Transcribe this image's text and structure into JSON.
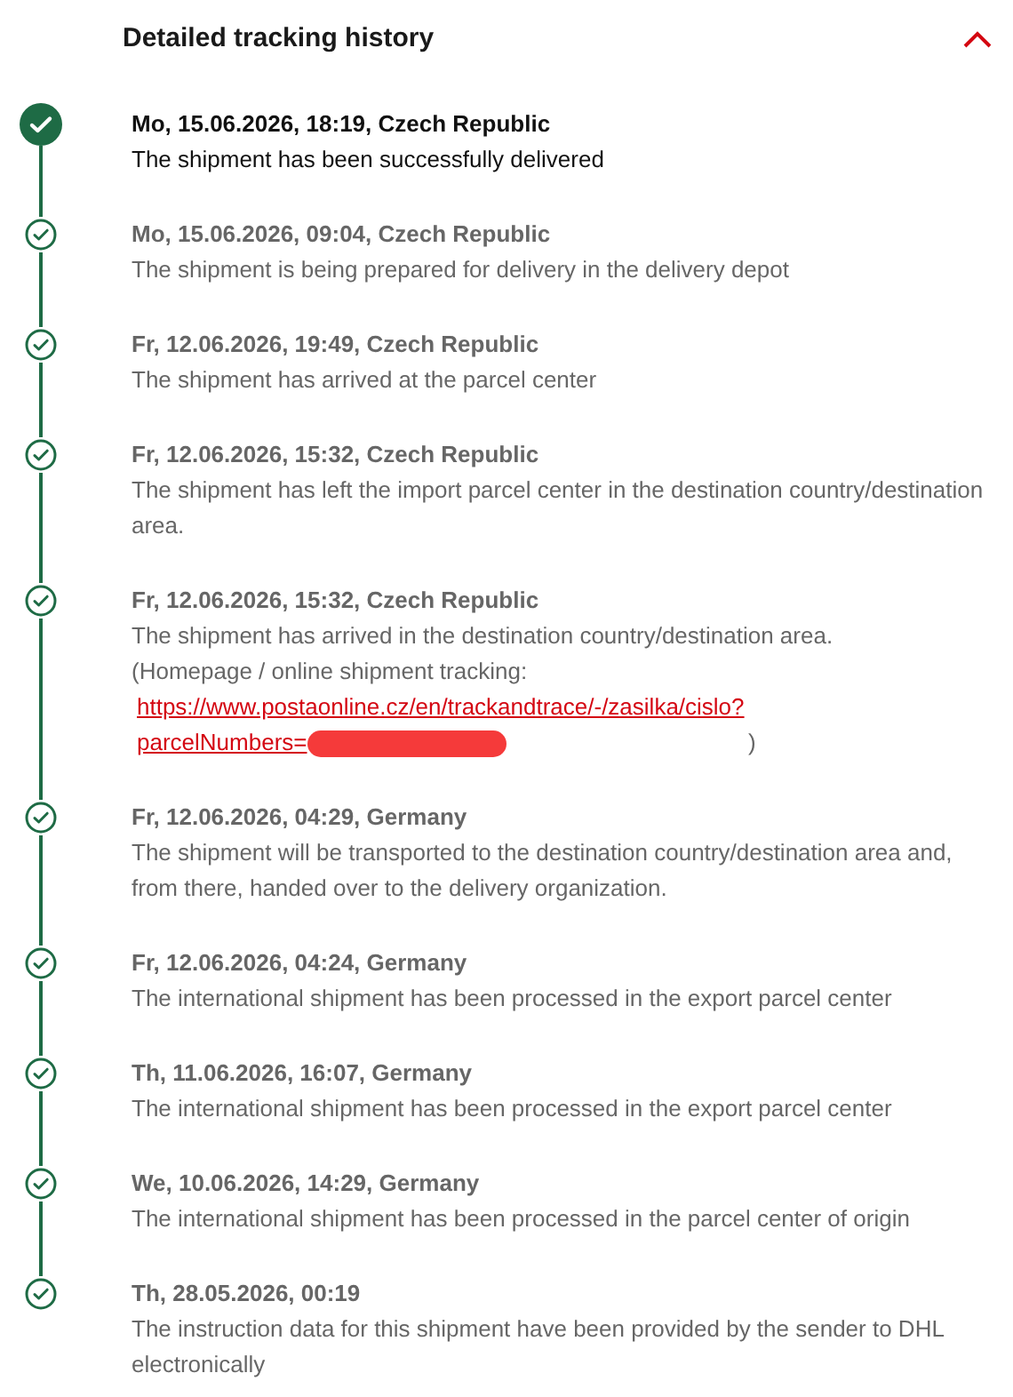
{
  "header": {
    "title": "Detailed tracking history",
    "expanded": true
  },
  "events": [
    {
      "kind": "current",
      "heading": "Mo, 15.06.2026, 18:19, Czech Republic",
      "description": "The shipment has been successfully delivered"
    },
    {
      "kind": "past",
      "heading": "Mo, 15.06.2026, 09:04, Czech Republic",
      "description": "The shipment is being prepared for delivery in the delivery depot"
    },
    {
      "kind": "past",
      "heading": "Fr, 12.06.2026, 19:49, Czech Republic",
      "description": "The shipment has arrived at the parcel center"
    },
    {
      "kind": "past",
      "heading": "Fr, 12.06.2026, 15:32, Czech Republic",
      "description": "The shipment has left the import parcel center in the destination country/destination area."
    },
    {
      "kind": "past",
      "heading": "Fr, 12.06.2026, 15:32, Czech Republic",
      "description": "The shipment has arrived in the destination country/destination area.",
      "note": "(Homepage / online shipment tracking:",
      "link": {
        "text": "https://www.postaonline.cz/en/trackandtrace/-/zasilka/cislo?parcelNumbers=",
        "redacted": true
      },
      "note_end": ")"
    },
    {
      "kind": "past",
      "heading": "Fr, 12.06.2026, 04:29, Germany",
      "description": "The shipment will be transported to the destination country/destination area and, from there, handed over to the delivery organization."
    },
    {
      "kind": "past",
      "heading": "Fr, 12.06.2026, 04:24, Germany",
      "description": "The international shipment has been processed in the export parcel center"
    },
    {
      "kind": "past",
      "heading": "Th, 11.06.2026, 16:07, Germany",
      "description": "The international shipment has been processed in the export parcel center"
    },
    {
      "kind": "past",
      "heading": "We, 10.06.2026, 14:29, Germany",
      "description": "The international shipment has been processed in the parcel center of origin"
    },
    {
      "kind": "past",
      "heading": "Th, 28.05.2026, 00:19",
      "description": "The instruction data for this shipment have been provided by the sender to DHL electronically"
    }
  ]
}
